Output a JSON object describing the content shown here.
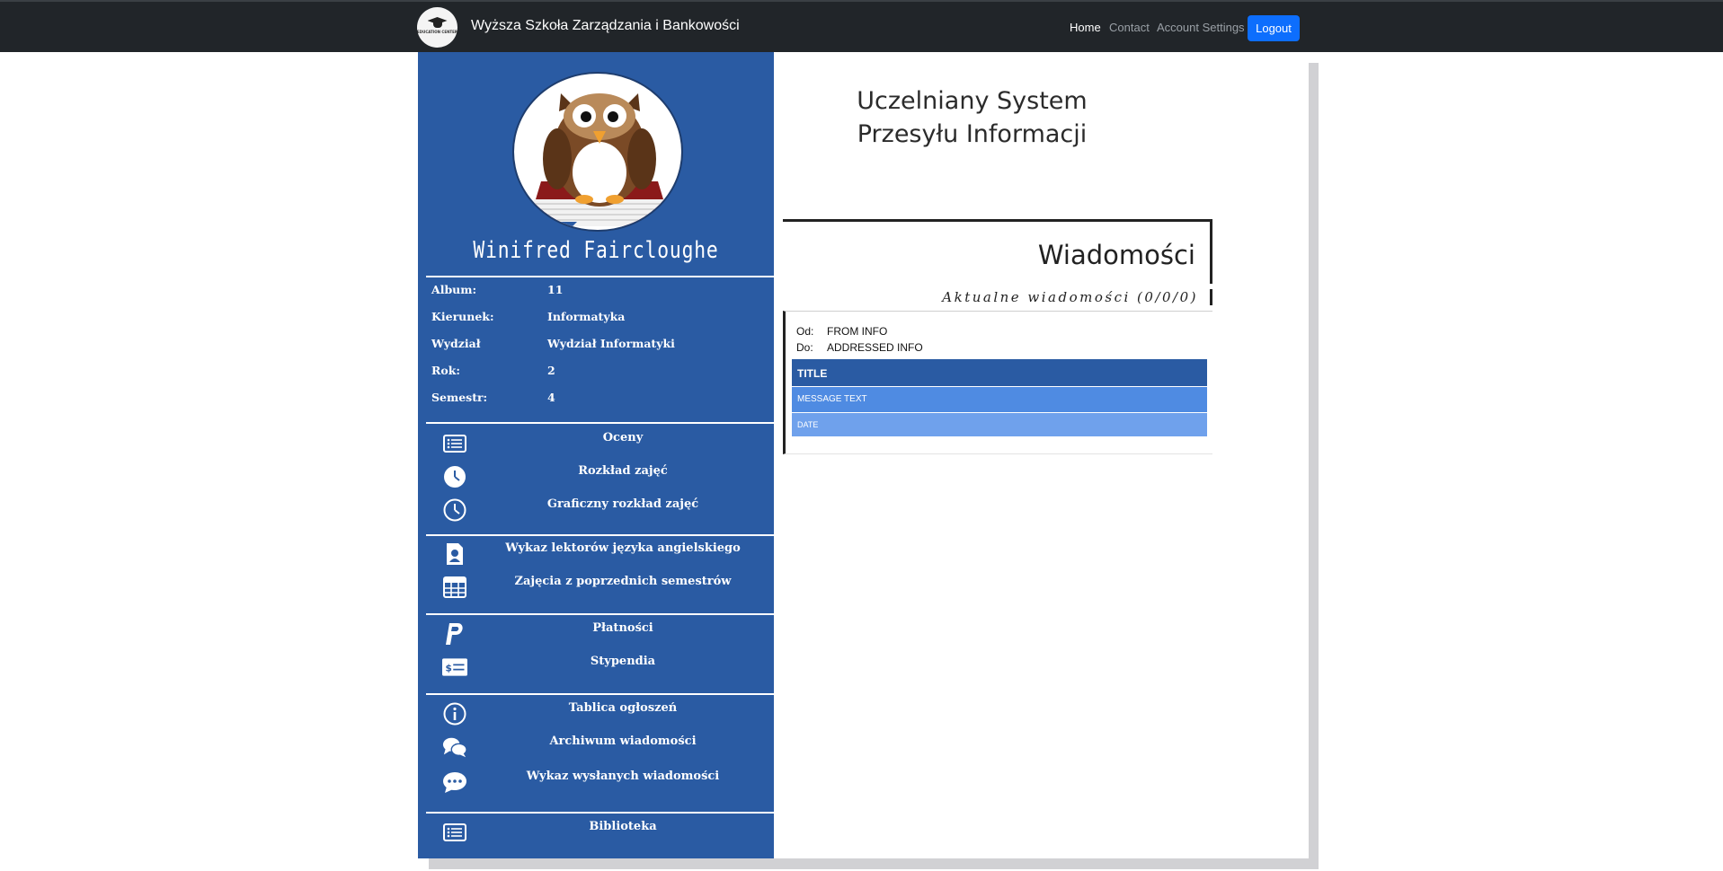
{
  "navbar": {
    "logo_text": "EDUCATION CENTER",
    "brand_name": "Wyższa Szkoła Zarządzania i Bankowości",
    "links": [
      "Home",
      "Contact",
      "Account Settings"
    ],
    "logout_label": "Logout"
  },
  "profile": {
    "name": "Winifred Faircloughe",
    "fields": [
      {
        "label": "Album:",
        "value": "11"
      },
      {
        "label": "Kierunek:",
        "value": "Informatyka"
      },
      {
        "label": "Wydział",
        "value": "Wydział Informatyki"
      },
      {
        "label": "Rok:",
        "value": "2"
      },
      {
        "label": "Semestr:",
        "value": "4"
      }
    ]
  },
  "menu": {
    "groups": [
      [
        {
          "label": "Oceny",
          "icon": "list-icon"
        },
        {
          "label": "Rozkład zajęć",
          "icon": "clock-icon"
        },
        {
          "label": "Graficzny rozkład zajęć",
          "icon": "clock-icon"
        }
      ],
      [
        {
          "label": "Wykaz lektorów języka angielskiego",
          "icon": "person-badge-icon"
        },
        {
          "label": "Zajęcia z poprzednich semestrów",
          "icon": "table-icon"
        }
      ],
      [
        {
          "label": "Płatności",
          "icon": "paypal-icon"
        },
        {
          "label": "Stypendia",
          "icon": "cash-icon"
        }
      ],
      [
        {
          "label": "Tablica ogłoszeń",
          "icon": "info-icon"
        },
        {
          "label": "Archiwum wiadomości",
          "icon": "chat-bubbles-icon"
        },
        {
          "label": "Wykaz wysłanych wiadomości",
          "icon": "chat-dots-icon"
        }
      ],
      [
        {
          "label": "Biblioteka",
          "icon": "list-icon"
        }
      ]
    ]
  },
  "main": {
    "title": "Uczelniany System Przesyłu Informacji",
    "messages": {
      "heading": "Wiadomości",
      "subheading": "Aktualne wiadomości (0/0/0)",
      "from_label": "Od:",
      "from_value": "FROM INFO",
      "to_label": "Do:",
      "to_value": "ADDRESSED INFO",
      "title": "TITLE",
      "text": "MESSAGE TEXT",
      "date": "DATE"
    }
  },
  "colors": {
    "navbar_bg": "#212529",
    "sidebar_bg": "#2a5ba3",
    "logout_btn": "#0d6efd",
    "row_title": "#2a5ba3",
    "row_text": "#4f8be2",
    "row_date": "#6fa1ec"
  }
}
